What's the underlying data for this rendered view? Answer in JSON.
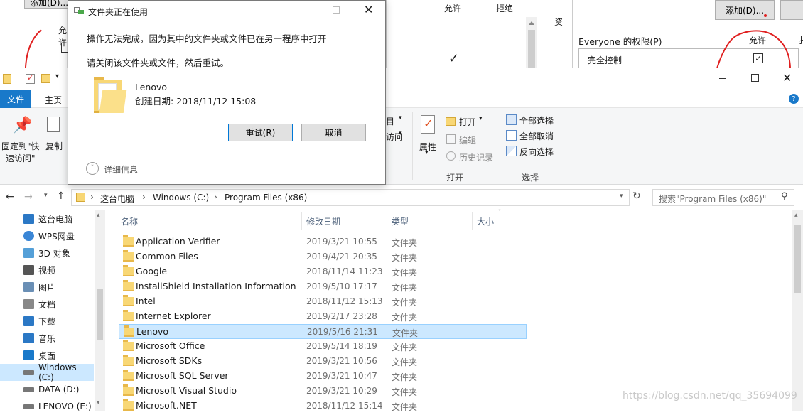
{
  "bg_left": {
    "add_button": "添加(D)...",
    "allow_header": "允许"
  },
  "bg_mid": {
    "allow_header": "允许",
    "deny_header": "拒绝",
    "side_char": "资",
    "check": "✓"
  },
  "bg_right": {
    "add_button": "添加(D)...",
    "perm_label": "Everyone 的权限(P)",
    "allow_header": "允许",
    "deny_header_partial": "扌",
    "full_control": "完全控制"
  },
  "dialog": {
    "title": "文件夹正在使用",
    "message": "操作无法完成，因为其中的文件夹或文件已在另一程序中打开",
    "instruction": "请关闭该文件夹或文件，然后重试。",
    "item_name": "Lenovo",
    "item_created": "创建日期: 2018/11/12 15:08",
    "retry_button": "重试(R)",
    "cancel_button": "取消",
    "details": "详细信息"
  },
  "explorer": {
    "tabs": {
      "file": "文件",
      "home": "主页"
    },
    "ribbon": {
      "pin_label_1": "固定到\"快",
      "pin_label_2": "速访问\"",
      "copy_label": "复制",
      "partial_1": "目",
      "partial_2": "访问",
      "properties": "属性",
      "open": "打开",
      "edit": "编辑",
      "history": "历史记录",
      "open_group": "打开",
      "select_all": "全部选择",
      "select_none": "全部取消",
      "invert_select": "反向选择",
      "select_group": "选择"
    },
    "address": {
      "seg1": "这台电脑",
      "seg2": "Windows (C:)",
      "seg3": "Program Files (x86)",
      "sep": "›"
    },
    "search_placeholder": "搜索\"Program Files (x86)\"",
    "columns": {
      "name": "名称",
      "date": "修改日期",
      "type": "类型",
      "size": "大小"
    },
    "nav": [
      {
        "label": "这台电脑",
        "icon": "computer-icon"
      },
      {
        "label": "WPS网盘",
        "icon": "cloud-icon"
      },
      {
        "label": "3D 对象",
        "icon": "cube-icon"
      },
      {
        "label": "视频",
        "icon": "video-icon"
      },
      {
        "label": "图片",
        "icon": "picture-icon"
      },
      {
        "label": "文档",
        "icon": "document-icon"
      },
      {
        "label": "下载",
        "icon": "download-icon"
      },
      {
        "label": "音乐",
        "icon": "music-icon"
      },
      {
        "label": "桌面",
        "icon": "desktop-icon"
      },
      {
        "label": "Windows (C:)",
        "icon": "drive-icon"
      },
      {
        "label": "DATA (D:)",
        "icon": "drive-icon"
      },
      {
        "label": "LENOVO (E:)",
        "icon": "drive-icon"
      }
    ],
    "files": [
      {
        "name": "Application Verifier",
        "date": "2019/3/21 10:55",
        "type": "文件夹"
      },
      {
        "name": "Common Files",
        "date": "2019/4/21 20:35",
        "type": "文件夹"
      },
      {
        "name": "Google",
        "date": "2018/11/14 11:23",
        "type": "文件夹"
      },
      {
        "name": "InstallShield Installation Information",
        "date": "2019/5/10 17:17",
        "type": "文件夹"
      },
      {
        "name": "Intel",
        "date": "2018/11/12 15:13",
        "type": "文件夹"
      },
      {
        "name": "Internet Explorer",
        "date": "2019/2/17 23:28",
        "type": "文件夹"
      },
      {
        "name": "Lenovo",
        "date": "2019/5/16 21:31",
        "type": "文件夹"
      },
      {
        "name": "Microsoft Office",
        "date": "2019/5/14 18:19",
        "type": "文件夹"
      },
      {
        "name": "Microsoft SDKs",
        "date": "2019/3/21 10:56",
        "type": "文件夹"
      },
      {
        "name": "Microsoft SQL Server",
        "date": "2019/3/21 10:47",
        "type": "文件夹"
      },
      {
        "name": "Microsoft Visual Studio",
        "date": "2019/3/21 10:29",
        "type": "文件夹"
      },
      {
        "name": "Microsoft.NET",
        "date": "2018/11/12 15:14",
        "type": "文件夹"
      }
    ]
  },
  "watermark": "https://blog.csdn.net/qq_35694099"
}
